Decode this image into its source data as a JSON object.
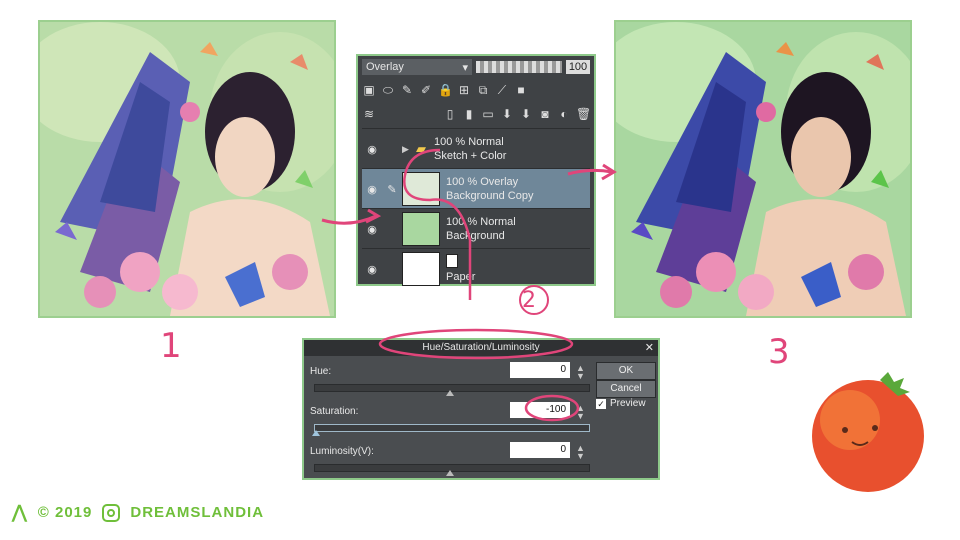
{
  "layers_panel": {
    "blend_mode": "Overlay",
    "opacity": "100",
    "layers": [
      {
        "mode": "100 % Normal",
        "name": "Sketch + Color",
        "type": "folder"
      },
      {
        "mode": "100 % Overlay",
        "name": "Background Copy",
        "type": "raster",
        "selected": true
      },
      {
        "mode": "100 % Normal",
        "name": "Background",
        "type": "raster"
      },
      {
        "mode": "",
        "name": "Paper",
        "type": "paper"
      }
    ]
  },
  "hsl_dialog": {
    "title": "Hue/Saturation/Luminosity",
    "hue_label": "Hue:",
    "hue_value": "0",
    "saturation_label": "Saturation:",
    "saturation_value": "-100",
    "luminosity_label": "Luminosity(V):",
    "luminosity_value": "0",
    "ok_label": "OK",
    "cancel_label": "Cancel",
    "preview_label": "Preview",
    "preview_checked": true
  },
  "steps": {
    "one": "1",
    "two": "2",
    "three": "3"
  },
  "footer": {
    "copyright": "© 2019",
    "handle": "DREAMSLANDIA"
  },
  "colors": {
    "accent": "#e0457a",
    "panel_border": "#8ec98a",
    "brand": "#6fbf3a"
  }
}
